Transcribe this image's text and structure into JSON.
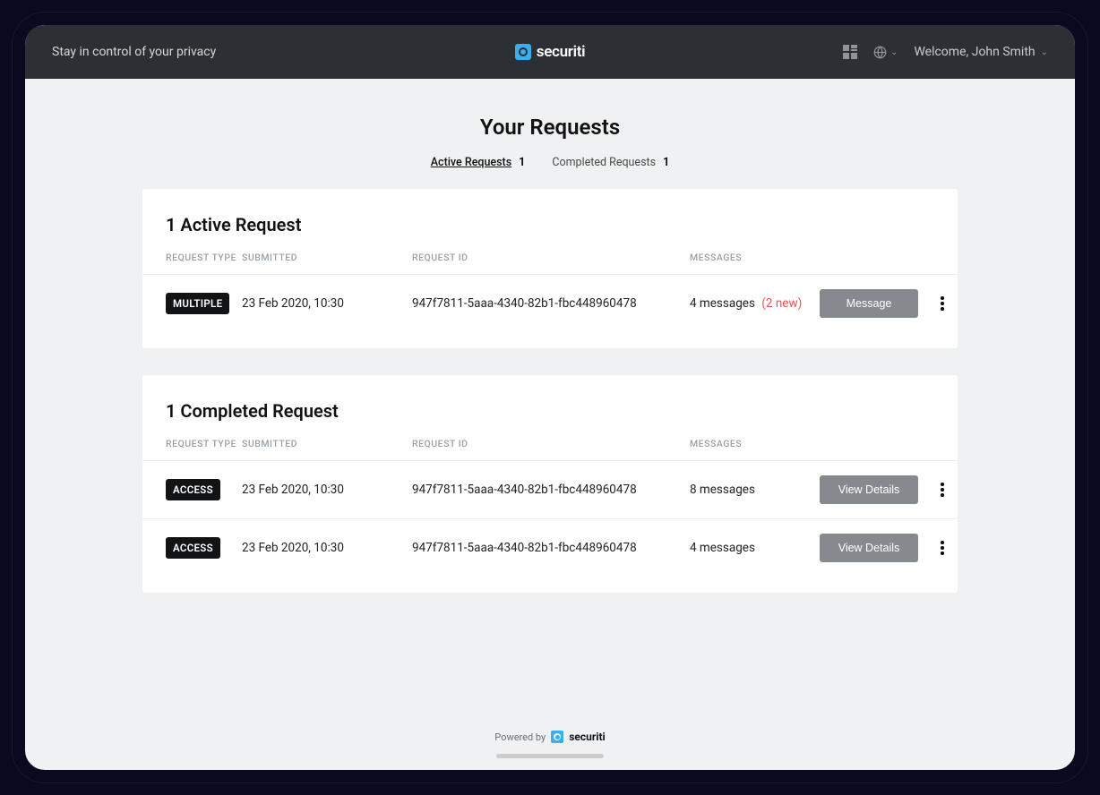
{
  "header": {
    "tagline": "Stay in control of your privacy",
    "brand": "securiti",
    "welcome": "Welcome, John Smith"
  },
  "page": {
    "title": "Your Requests"
  },
  "tabs": {
    "active": {
      "label": "Active Requests",
      "count": "1"
    },
    "completed": {
      "label": "Completed Requests",
      "count": "1"
    }
  },
  "activePanel": {
    "title": "1 Active Request",
    "columns": {
      "type": "REQUEST TYPE",
      "submitted": "SUBMITTED",
      "id": "REQUEST ID",
      "messages": "MESSAGES"
    },
    "rows": [
      {
        "type": "MULTIPLE",
        "submitted": "23 Feb 2020, 10:30",
        "id": "947f7811-5aaa-4340-82b1-fbc448960478",
        "messages": "4 messages",
        "newMessages": "(2 new)",
        "action": "Message"
      }
    ]
  },
  "completedPanel": {
    "title": "1 Completed Request",
    "columns": {
      "type": "REQUEST TYPE",
      "submitted": "SUBMITTED",
      "id": "REQUEST ID",
      "messages": "MESSAGES"
    },
    "rows": [
      {
        "type": "ACCESS",
        "submitted": "23 Feb 2020, 10:30",
        "id": "947f7811-5aaa-4340-82b1-fbc448960478",
        "messages": "8 messages",
        "action": "View Details"
      },
      {
        "type": "ACCESS",
        "submitted": "23 Feb 2020, 10:30",
        "id": "947f7811-5aaa-4340-82b1-fbc448960478",
        "messages": "4 messages",
        "action": "View Details"
      }
    ]
  },
  "footer": {
    "poweredBy": "Powered by",
    "brand": "securiti"
  }
}
